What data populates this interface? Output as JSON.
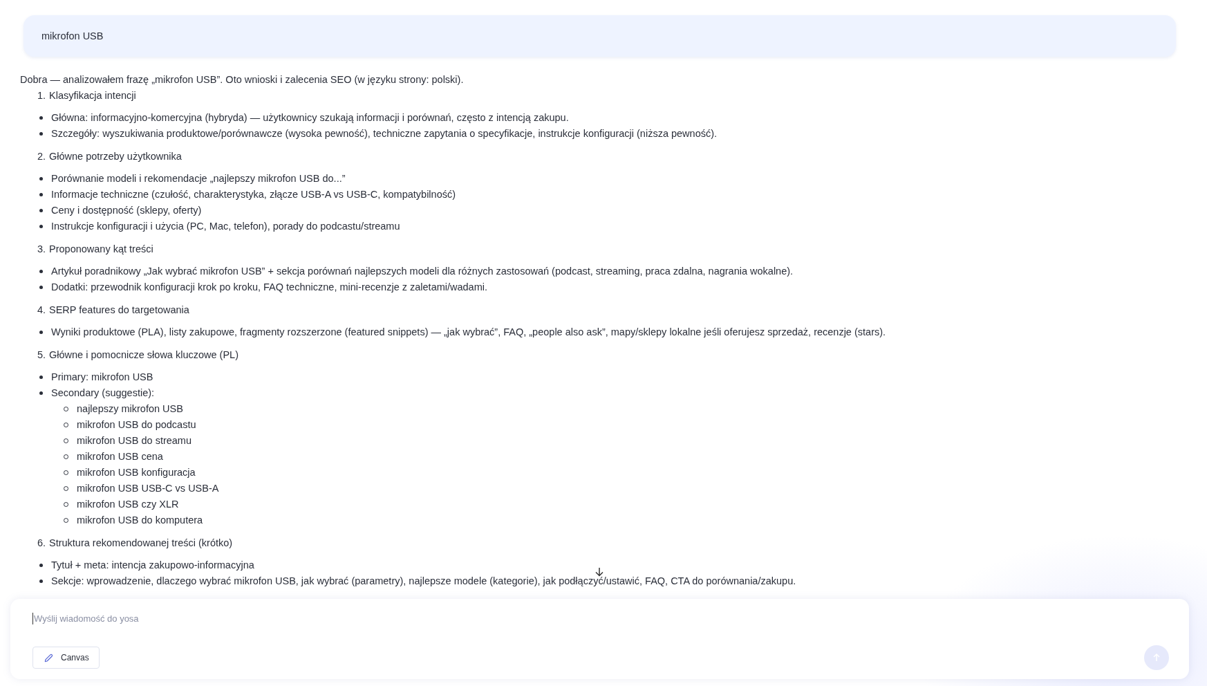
{
  "user_message": "mikrofon USB",
  "intro": "Dobra — analizowałem frazę „mikrofon USB”. Oto wnioski i zalecenia SEO (w języku strony: polski).",
  "sections": [
    {
      "number": "1.",
      "title": "Klasyfikacja intencji",
      "bullets": [
        {
          "text": "Główna: informacyjno-komercyjna (hybryda) — użytkownicy szukają informacji i porównań, często z intencją zakupu."
        },
        {
          "text": "Szczegóły: wyszukiwania produktowe/porównawcze (wysoka pewność), techniczne zapytania o specyfikacje, instrukcje konfiguracji (niższa pewność)."
        }
      ]
    },
    {
      "number": "2.",
      "title": "Główne potrzeby użytkownika",
      "bullets": [
        {
          "text": "Porównanie modeli i rekomendacje „najlepszy mikrofon USB do...”"
        },
        {
          "text": "Informacje techniczne (czułość, charakterystyka, złącze USB-A vs USB-C, kompatybilność)"
        },
        {
          "text": "Ceny i dostępność (sklepy, oferty)"
        },
        {
          "text": "Instrukcje konfiguracji i użycia (PC, Mac, telefon), porady do podcastu/streamu"
        }
      ]
    },
    {
      "number": "3.",
      "title": "Proponowany kąt treści",
      "bullets": [
        {
          "text": "Artykuł poradnikowy „Jak wybrać mikrofon USB” + sekcja porównań najlepszych modeli dla różnych zastosowań (podcast, streaming, praca zdalna, nagrania wokalne)."
        },
        {
          "text": "Dodatki: przewodnik konfiguracji krok po kroku, FAQ techniczne, mini-recenzje z zaletami/wadami."
        }
      ]
    },
    {
      "number": "4.",
      "title": "SERP features do targetowania",
      "bullets": [
        {
          "text": "Wyniki produktowe (PLA), listy zakupowe, fragmenty rozszerzone (featured snippets) — „jak wybrać”, FAQ, „people also ask”, mapy/sklepy lokalne jeśli oferujesz sprzedaż, recenzje (stars)."
        }
      ]
    },
    {
      "number": "5.",
      "title": "Główne i pomocnicze słowa kluczowe (PL)",
      "bullets": [
        {
          "text": "Primary: mikrofon USB"
        },
        {
          "text": "Secondary (suggestie):",
          "children": [
            {
              "text": "najlepszy mikrofon USB"
            },
            {
              "text": "mikrofon USB do podcastu"
            },
            {
              "text": "mikrofon USB do streamu"
            },
            {
              "text": "mikrofon USB cena"
            },
            {
              "text": "mikrofon USB konfiguracja"
            },
            {
              "text": "mikrofon USB USB-C vs USB-A"
            },
            {
              "text": "mikrofon USB czy XLR"
            },
            {
              "text": "mikrofon USB do komputera"
            }
          ]
        }
      ]
    },
    {
      "number": "6.",
      "title": "Struktura rekomendowanej treści (krótko)",
      "bullets": [
        {
          "text": "Tytuł + meta: intencja zakupowo-informacyjna"
        },
        {
          "text": "Sekcje: wprowadzenie, dlaczego wybrać mikrofon USB, jak wybrać (parametry), najlepsze modele (kategorie), jak podłączyć/ustawić, FAQ, CTA do porównania/zakupu."
        }
      ]
    }
  ],
  "composer": {
    "placeholder": "Wyślij wiadomość do yosa",
    "canvas_button": "Canvas",
    "send_disabled": true
  }
}
